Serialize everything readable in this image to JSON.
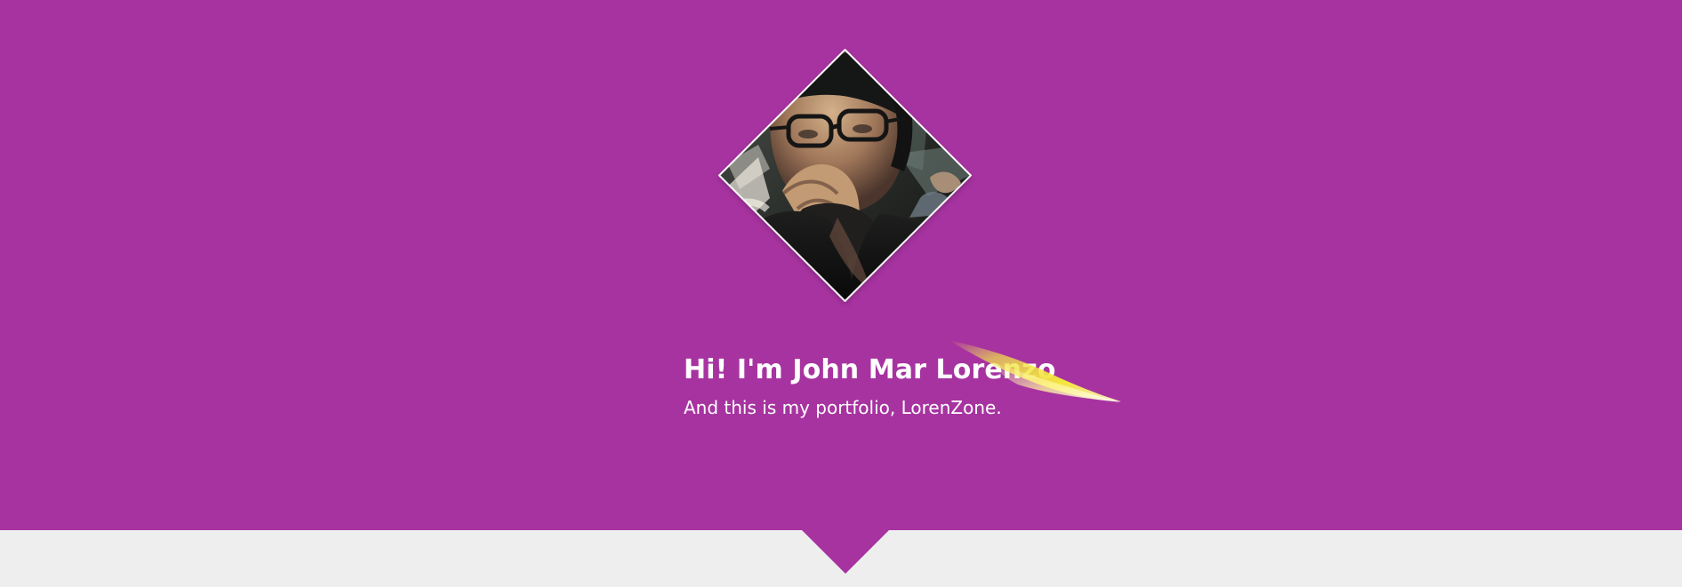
{
  "hero": {
    "title": "Hi! I'm John Mar Lorenzo",
    "subtitle": "And this is my portfolio, LorenZone.",
    "background_color": "#a733a0",
    "avatar_icon": "profile-photo-icon",
    "accent_color": "#f4e63d"
  },
  "page": {
    "lower_background_color": "#efeeef",
    "notch_icon": "down-pointer-icon"
  }
}
